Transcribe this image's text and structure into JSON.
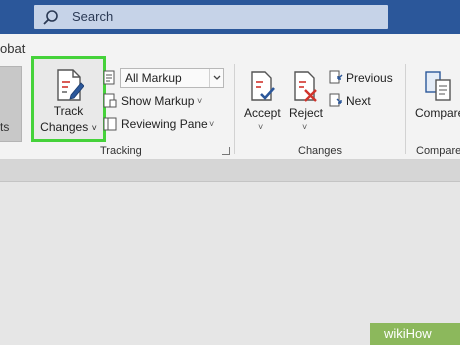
{
  "search": {
    "label": "Search"
  },
  "tabrow": {
    "partial_label": "obat"
  },
  "left_group": {
    "partial_label": "ts"
  },
  "tracking": {
    "track_changes_line1": "Track",
    "track_changes_line2": "Changes",
    "markup_value": "All Markup",
    "show_markup": "Show Markup",
    "reviewing_pane": "Reviewing Pane",
    "group_label": "Tracking"
  },
  "changes": {
    "accept": "Accept",
    "reject": "Reject",
    "previous": "Previous",
    "next": "Next",
    "group_label": "Changes"
  },
  "compare": {
    "button": "Compare",
    "group_label": "Compare"
  },
  "watermark": {
    "text": "wikiHow"
  },
  "colors": {
    "titlebar": "#2b579a",
    "highlight": "#45d23a",
    "reject_red": "#d0342c",
    "accent_blue": "#2b579a"
  },
  "icons": [
    "search-icon",
    "track-changes-icon",
    "markup-icon",
    "show-markup-icon",
    "reviewing-pane-icon",
    "accept-icon",
    "reject-icon",
    "previous-icon",
    "next-icon",
    "compare-icon"
  ]
}
